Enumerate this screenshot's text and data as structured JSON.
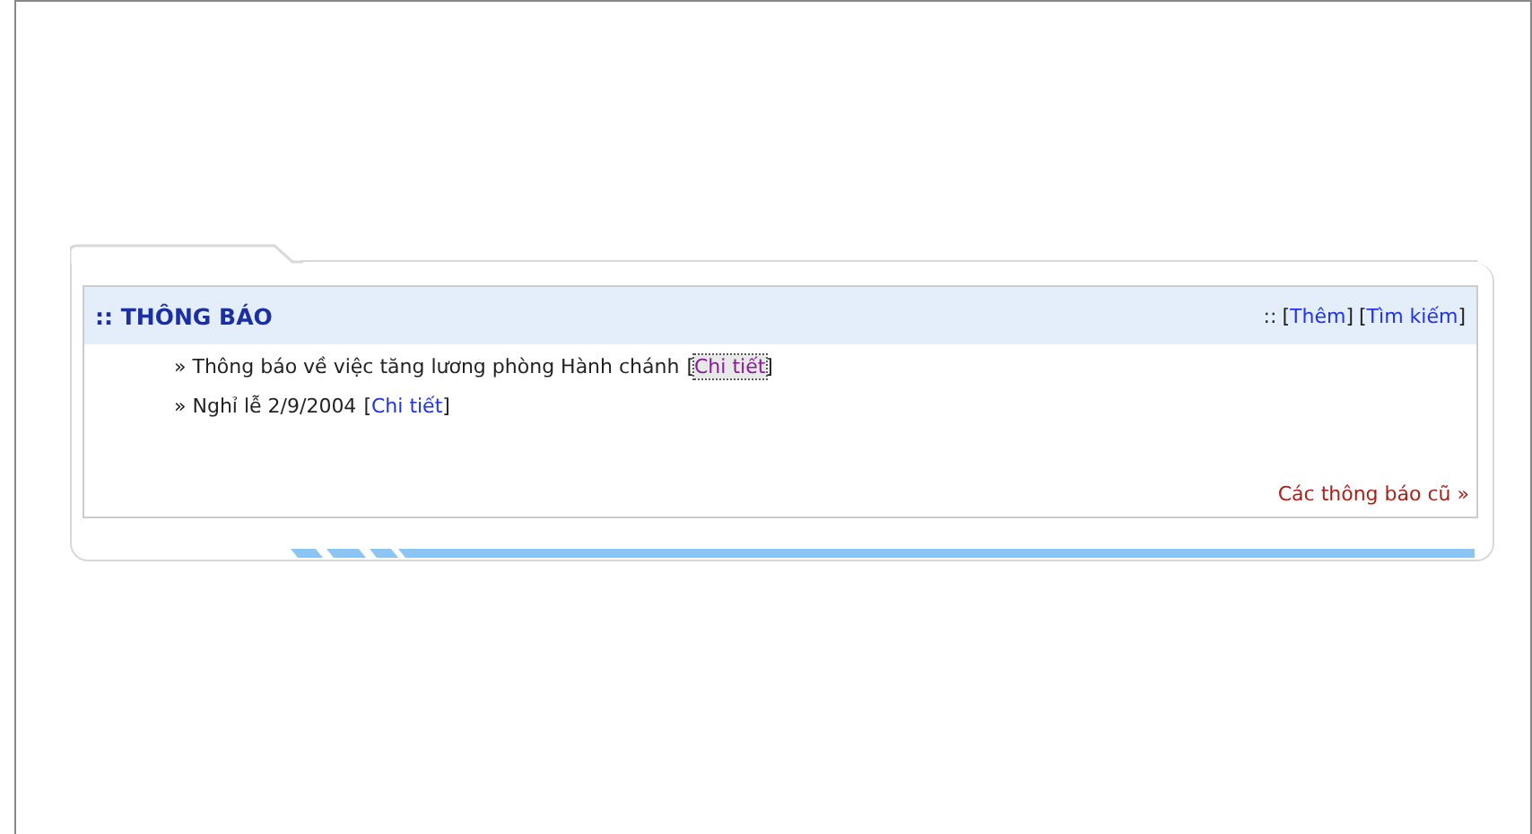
{
  "panel": {
    "title": ":: THÔNG BÁO",
    "actions_prefix": "::",
    "actions": [
      {
        "open": "[",
        "label": "Thêm",
        "close": "]"
      },
      {
        "open": "[",
        "label": "Tìm kiếm",
        "close": "]"
      }
    ],
    "items": [
      {
        "bullet": "»",
        "text": "Thông báo về việc tăng lương phòng Hành chánh",
        "open": "[",
        "link": {
          "label": "Chi tiết",
          "visited": true,
          "focused": true
        },
        "close": "]"
      },
      {
        "bullet": "»",
        "text": "Nghỉ lễ 2/9/2004",
        "open": "[",
        "link": {
          "label": "Chi tiết",
          "visited": false,
          "focused": false
        },
        "close": "]"
      }
    ],
    "more_link": "Các thông báo cũ »"
  }
}
